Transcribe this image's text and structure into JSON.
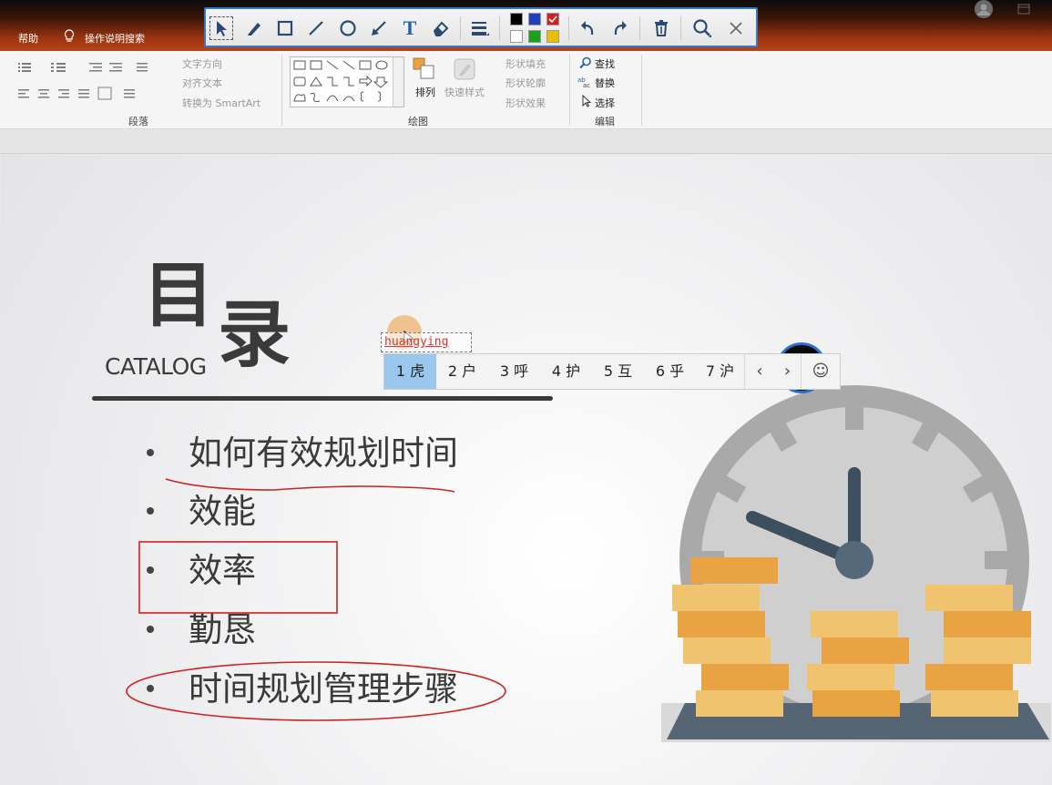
{
  "titlebar": {
    "help_menu": "帮助",
    "search_menu": "操作说明搜索"
  },
  "annotation_toolbar": {
    "tools": [
      "pointer-icon",
      "pen-icon",
      "rectangle-icon",
      "line-icon",
      "ellipse-icon",
      "arrow-icon",
      "text-icon",
      "eraser-icon",
      "line-width-icon",
      "undo-icon",
      "redo-icon",
      "trash-icon",
      "zoom-icon",
      "close-icon"
    ],
    "text_tool_glyph": "T",
    "colors": [
      "#000000",
      "#1f3fbf",
      "#d02020",
      "#ffffff",
      "#1aa01a",
      "#e8c000"
    ]
  },
  "ribbon": {
    "paragraph": {
      "label": "段落",
      "text_direction": "文字方向",
      "align_text": "对齐文本",
      "convert_smartart": "转换为 SmartArt"
    },
    "drawing": {
      "label": "绘图",
      "arrange": "排列",
      "quick_styles": "快速样式",
      "shape_fill": "形状填充",
      "shape_outline": "形状轮廓",
      "shape_effects": "形状效果"
    },
    "editing": {
      "label": "编辑",
      "find": "查找",
      "replace": "替换",
      "select": "选择"
    }
  },
  "slide": {
    "title_char1": "目",
    "title_char2": "录",
    "subtitle": "CATALOG",
    "items": [
      "如何有效规划时间",
      "效能",
      "效率",
      "勤恳",
      "时间规划管理步骤"
    ]
  },
  "ime": {
    "pinyin": "huangying",
    "candidates": [
      "1 虎",
      "2 户",
      "3 呼",
      "4 护",
      "5 互",
      "6 乎",
      "7 沪"
    ],
    "prev": "‹",
    "next": "›",
    "emoji": "☺"
  },
  "colors": {
    "accent": "#3b78c4",
    "ink": "#d02020",
    "coin_dark": "#e9a343",
    "coin_light": "#f0c46e",
    "clock_face": "#cfcfcf",
    "clock_ring": "#a9a9a9",
    "clock_hand": "#3d4f5e",
    "base": "#566573"
  }
}
